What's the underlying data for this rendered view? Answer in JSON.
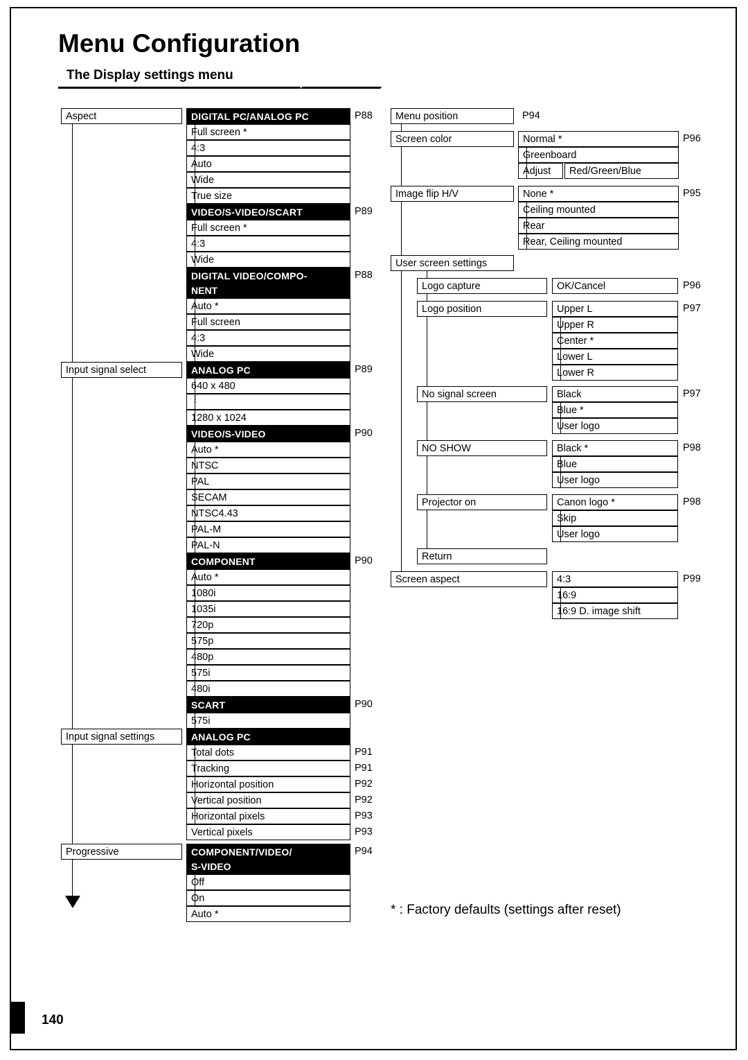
{
  "page": {
    "title": "Menu Configuration",
    "subtitle": "The Display settings menu",
    "number": "140",
    "footnote": "* : Factory defaults (settings after reset)"
  },
  "left_column": {
    "groups": [
      {
        "label": "Aspect",
        "sections": [
          {
            "header": "DIGITAL PC/ANALOG PC",
            "page": "P88",
            "items": [
              "Full screen *",
              "4:3",
              "Auto",
              "Wide",
              "True size"
            ]
          },
          {
            "header": "VIDEO/S-VIDEO/SCART",
            "page": "P89",
            "items": [
              "Full screen *",
              "4:3",
              "Wide"
            ]
          },
          {
            "header": "DIGITAL VIDEO/COMPO-",
            "header2": "NENT",
            "page": "P88",
            "items": [
              "Auto *",
              "Full screen",
              "4:3",
              "Wide"
            ]
          }
        ]
      },
      {
        "label": "Input signal select",
        "sections": [
          {
            "header": "ANALOG PC",
            "page": "P89",
            "items": [
              "640 x 480",
              "",
              "1280 x 1024"
            ],
            "ellipsis": true
          },
          {
            "header": "VIDEO/S-VIDEO",
            "page": "P90",
            "items": [
              "Auto *",
              "NTSC",
              "PAL",
              "SECAM",
              "NTSC4.43",
              "PAL-M",
              "PAL-N"
            ]
          },
          {
            "header": "COMPONENT",
            "page": "P90",
            "items": [
              "Auto *",
              "1080i",
              "1035i",
              "720p",
              "575p",
              "480p",
              "575i",
              "480i"
            ]
          },
          {
            "header": "SCART",
            "page": "P90",
            "items": [
              "575i"
            ]
          }
        ]
      },
      {
        "label": "Input signal settings",
        "sections": [
          {
            "header": "ANALOG PC",
            "page": "",
            "items": [
              "Total dots",
              "Tracking",
              "Horizontal position",
              "Vertical position",
              "Horizontal pixels",
              "Vertical pixels"
            ],
            "item_pages": [
              "P91",
              "P91",
              "P92",
              "P92",
              "P93",
              "P93"
            ]
          }
        ]
      },
      {
        "label": "Progressive",
        "sections": [
          {
            "header": "COMPONENT/VIDEO/",
            "header2": "S-VIDEO",
            "page": "P94",
            "items": [
              "Off",
              "On",
              "Auto *"
            ]
          }
        ]
      }
    ]
  },
  "right_column": {
    "rows": [
      {
        "label": "Menu position",
        "page": "P94",
        "values": []
      },
      {
        "label": "Screen color",
        "page": "P96",
        "values": [
          "Normal *",
          "Greenboard"
        ],
        "split_row": {
          "left": "Adjust",
          "right": "Red/Green/Blue"
        }
      },
      {
        "label": "Image flip H/V",
        "page": "P95",
        "values": [
          "None *",
          "Ceiling mounted",
          "Rear",
          "Rear, Ceiling mounted"
        ]
      },
      {
        "label": "User screen settings",
        "page": "",
        "values": []
      }
    ],
    "user_screen": [
      {
        "label": "Logo capture",
        "page": "P96",
        "values": [
          "OK/Cancel"
        ]
      },
      {
        "label": "Logo position",
        "page": "P97",
        "values": [
          "Upper L",
          "Upper R",
          "Center *",
          "Lower L",
          "Lower R"
        ]
      },
      {
        "label": "No signal screen",
        "page": "P97",
        "values": [
          "Black",
          "Blue *",
          "User logo"
        ]
      },
      {
        "label": "NO SHOW",
        "page": "P98",
        "values": [
          "Black *",
          "Blue",
          "User logo"
        ]
      },
      {
        "label": "Projector on",
        "page": "P98",
        "values": [
          "Canon logo *",
          "Skip",
          "User logo"
        ]
      },
      {
        "label": "Return",
        "page": "",
        "values": []
      }
    ],
    "screen_aspect": {
      "label": "Screen aspect",
      "page": "P99",
      "values": [
        "4:3",
        "16:9",
        "16:9 D. image shift"
      ]
    }
  }
}
